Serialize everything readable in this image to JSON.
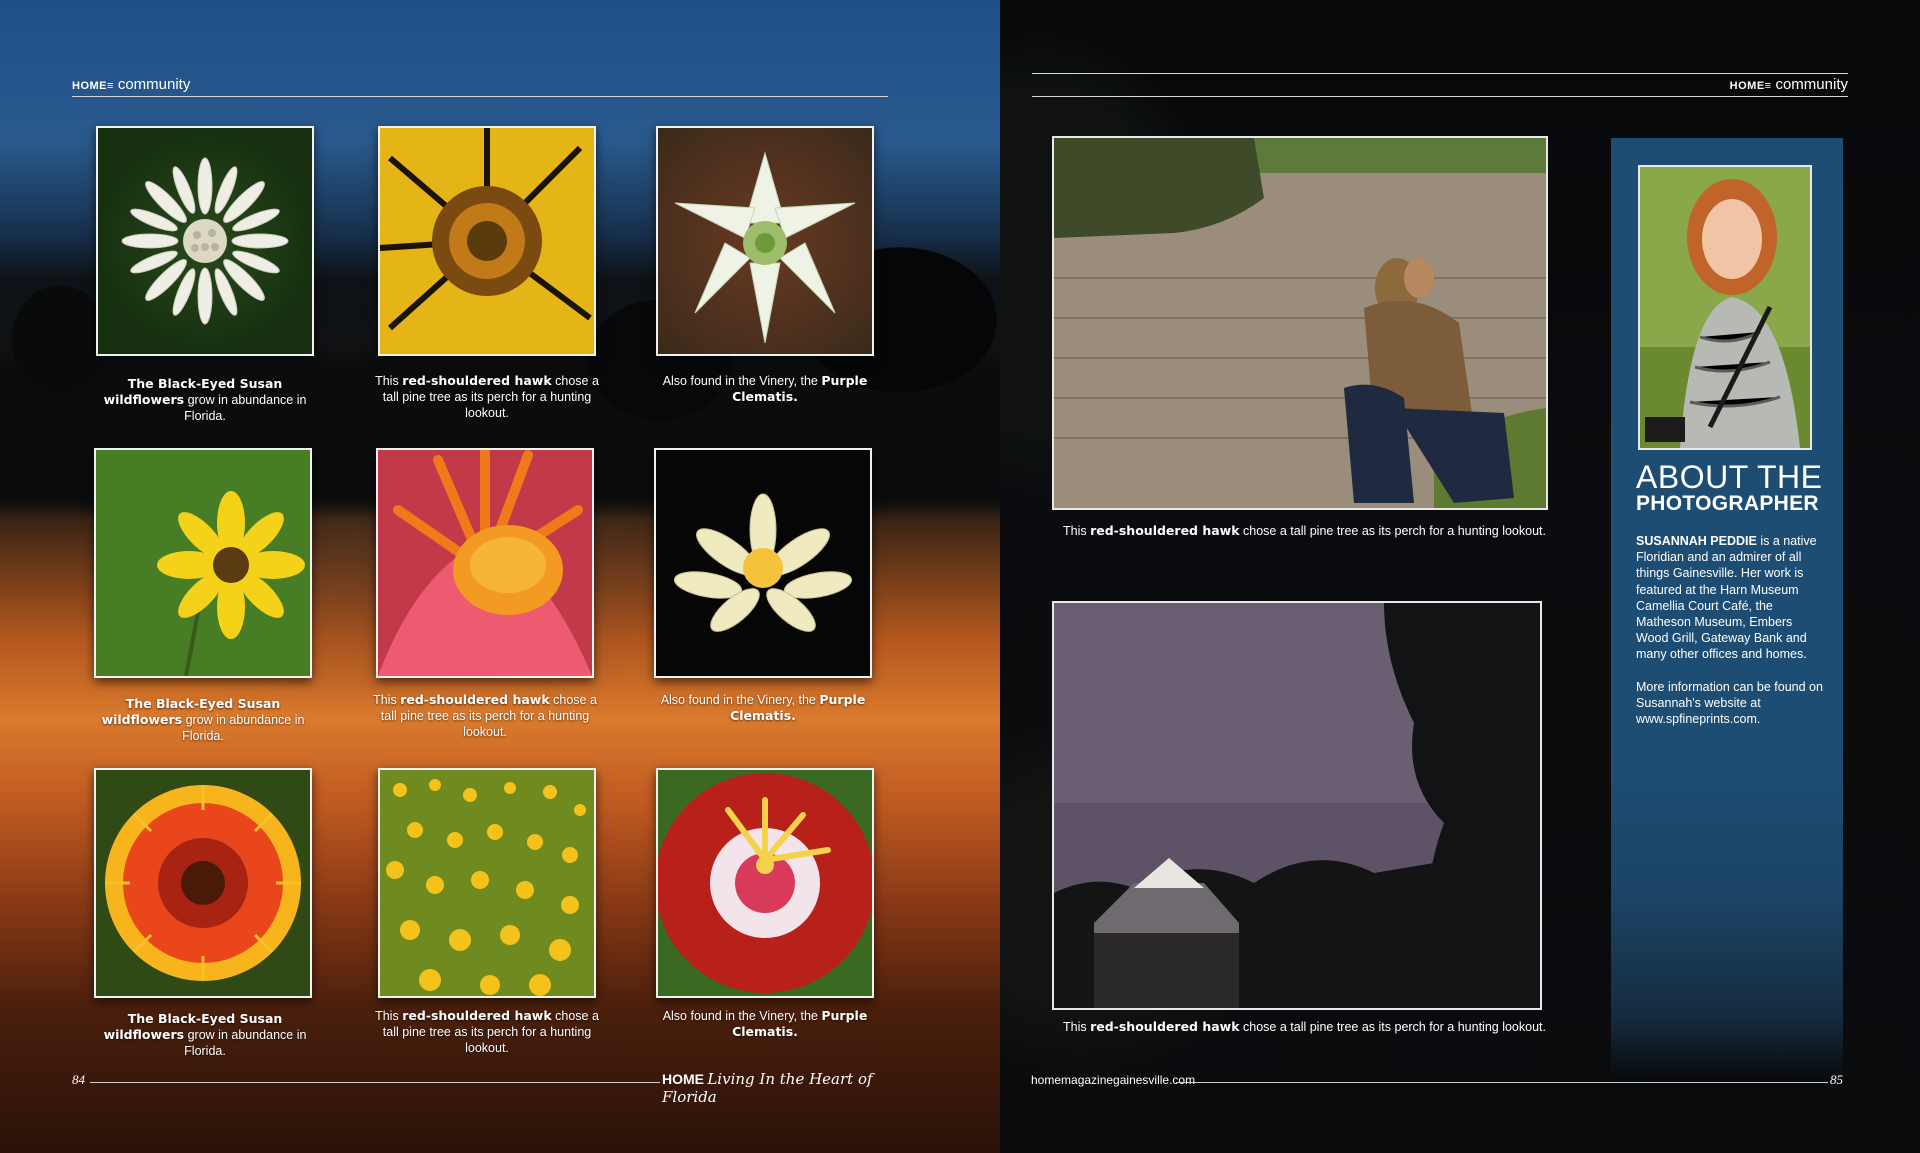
{
  "left_header": {
    "brand": "HOME",
    "brand_suffix": "≡",
    "section": "community"
  },
  "right_header": {
    "brand": "HOME",
    "brand_suffix": "≡",
    "section": "community"
  },
  "grid": [
    {
      "caption_lead": "",
      "caption_bold": "The Black-Eyed Susan wildflowers",
      "caption_tail": " grow in abundance in Florida.",
      "icon": "white-flower"
    },
    {
      "caption_lead": "This ",
      "caption_bold": "red-shouldered hawk",
      "caption_tail": " chose a tall pine tree as its perch for a hunting lookout.",
      "icon": "yellow-flower"
    },
    {
      "caption_lead": "Also found in the Vinery, the ",
      "caption_bold": "Purple Clematis.",
      "caption_tail": "",
      "icon": "white-green-flower"
    },
    {
      "caption_lead": "",
      "caption_bold": "The Black-Eyed Susan wildflowers",
      "caption_tail": " grow in abundance in Florida.",
      "icon": "black-eyed-susan"
    },
    {
      "caption_lead": "This ",
      "caption_bold": "red-shouldered hawk",
      "caption_tail": " chose a tall pine tree as its perch for a hunting lookout.",
      "icon": "orange-lily"
    },
    {
      "caption_lead": "Also found in the Vinery, the ",
      "caption_bold": "Purple Clematis.",
      "caption_tail": "",
      "icon": "water-lily"
    },
    {
      "caption_lead": "",
      "caption_bold": "The Black-Eyed Susan wildflowers",
      "caption_tail": " grow in abundance in Florida.",
      "icon": "gaillardia"
    },
    {
      "caption_lead": "This ",
      "caption_bold": "red-shouldered hawk",
      "caption_tail": " chose a tall pine tree as its perch for a hunting lookout.",
      "icon": "buttercup-field"
    },
    {
      "caption_lead": "Also found in the Vinery, the ",
      "caption_bold": "Purple Clematis.",
      "caption_tail": "",
      "icon": "passion-flower"
    }
  ],
  "big_photos": [
    {
      "caption_lead": "This ",
      "caption_bold": "red-shouldered hawk",
      "caption_tail": " chose a tall pine tree as its perch for a hunting lookout.",
      "icon": "lake-mother-child"
    },
    {
      "caption_lead": "This ",
      "caption_bold": "red-shouldered hawk",
      "caption_tail": " chose a tall pine tree as its perch for a hunting lookout.",
      "icon": "dusk-sky-house"
    }
  ],
  "about": {
    "title_line1": "ABOUT THE",
    "title_line2": "PHOTOGRAPHER",
    "name": "SUSANNAH PEDDIE",
    "bio": " is a native Floridian and an admirer of all things Gainesville. Her work is featured at the Harn Museum Camellia Court Café, the Matheson Museum, Embers Wood Grill, Gateway Bank and many other offices and homes.",
    "more": "More information can be found on Susannah's website at www.spfineprints.com.",
    "portrait_icon": "photographer-portrait"
  },
  "footer": {
    "left_page": "84",
    "brand": "HOME",
    "tagline": "Living In the Heart of Florida",
    "website": "homemagazinegainesville.com",
    "right_page": "85"
  }
}
